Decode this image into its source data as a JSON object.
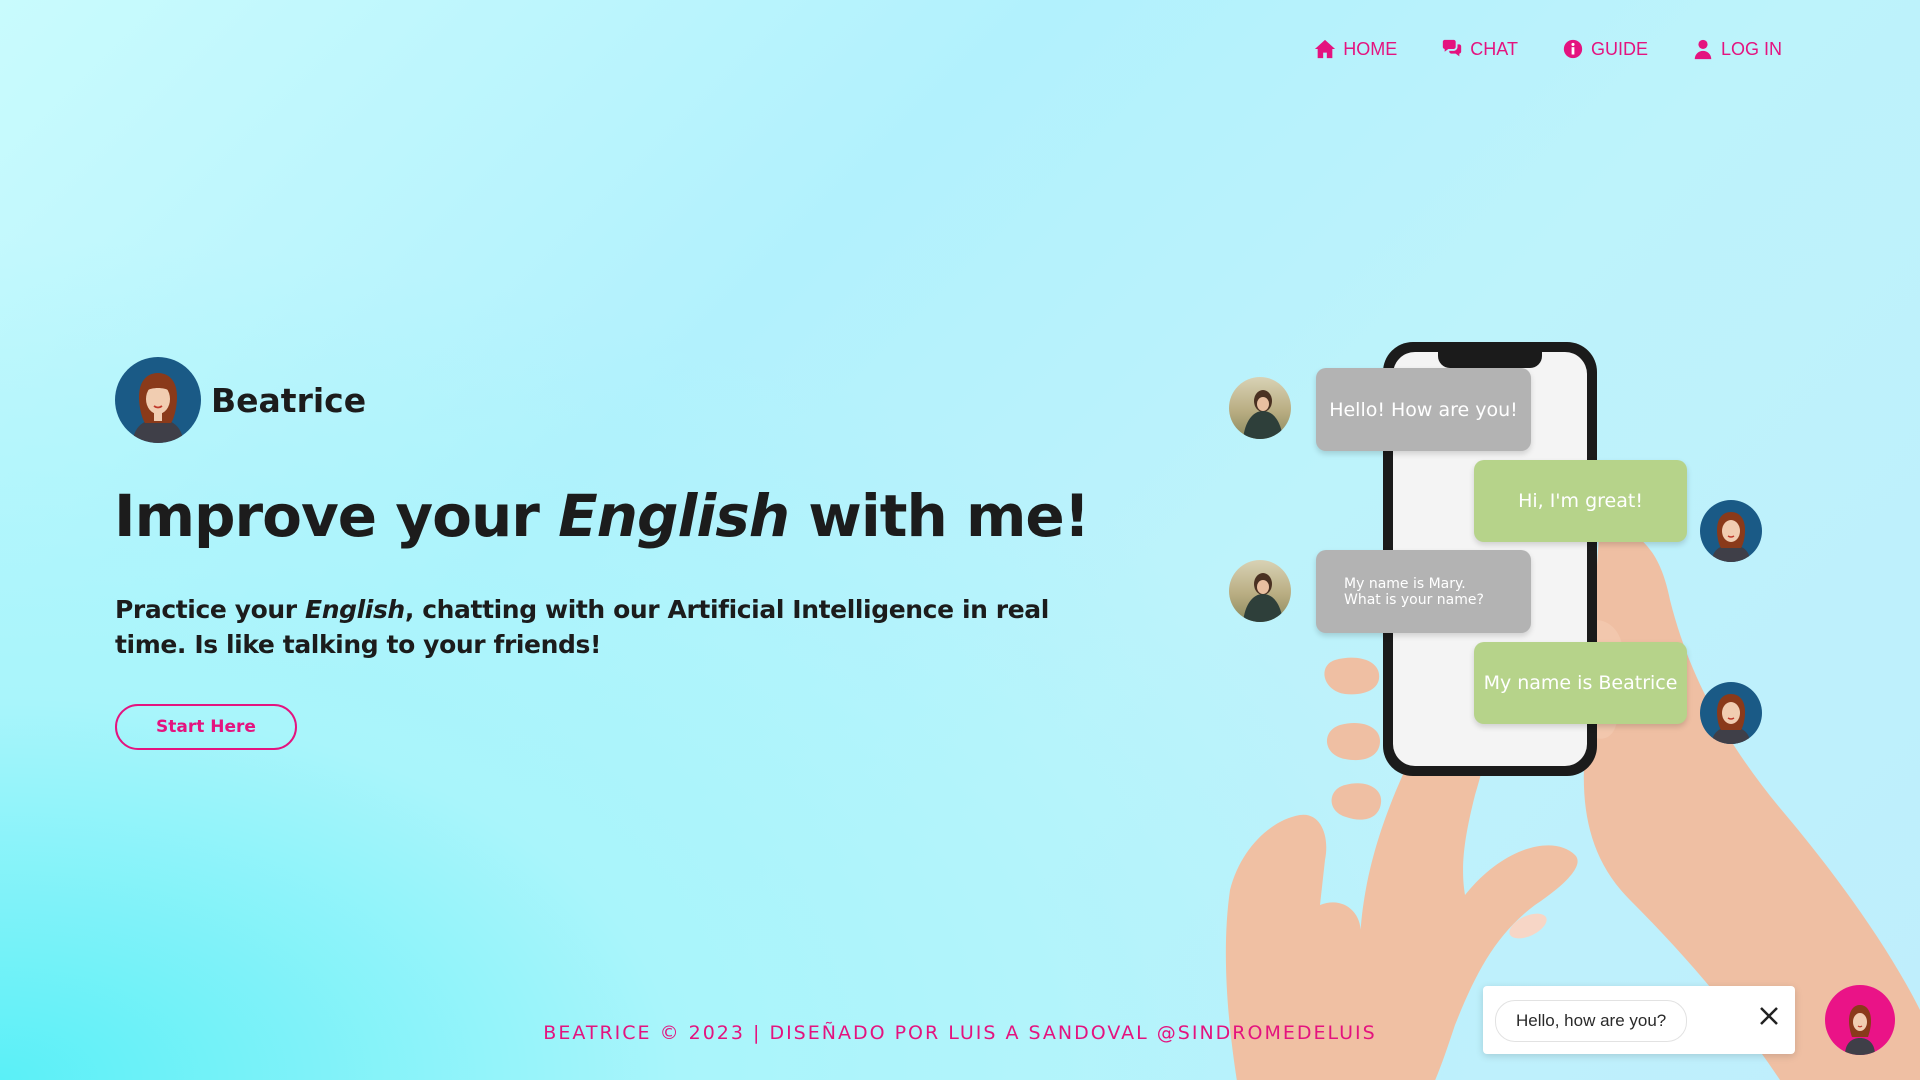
{
  "nav": {
    "items": [
      {
        "label": "HOME",
        "icon": "home-icon"
      },
      {
        "label": "CHAT",
        "icon": "chat-icon"
      },
      {
        "label": "GUIDE",
        "icon": "info-icon"
      },
      {
        "label": "LOG IN",
        "icon": "user-icon"
      }
    ]
  },
  "brand": {
    "name": "Beatrice"
  },
  "hero": {
    "title_pre": "Improve your ",
    "title_em": "English",
    "title_post": " with me!",
    "sub_pre": "Practice your ",
    "sub_em": "English",
    "sub_post": ", chatting with our Artificial Intelligence in real time. Is like talking to your friends!",
    "cta": "Start Here"
  },
  "illustration": {
    "bubbles": [
      {
        "text": "Hello! How are you!",
        "sender": "user"
      },
      {
        "text": "Hi, I'm great!",
        "sender": "beatrice"
      },
      {
        "text": "My name is Mary. What is your name?",
        "sender": "user"
      },
      {
        "text": "My name is Beatrice",
        "sender": "beatrice"
      }
    ]
  },
  "footer": {
    "text": "BEATRICE © 2023 | DISEÑADO POR LUIS A SANDOVAL @SINDROMEDELUIS"
  },
  "chat_widget": {
    "message": "Hello, how are you?"
  },
  "colors": {
    "accent": "#e4137f",
    "bubble_gray": "#b3b3b3",
    "bubble_green": "#b6d38a",
    "avatar_bg": "#1a5a86"
  }
}
